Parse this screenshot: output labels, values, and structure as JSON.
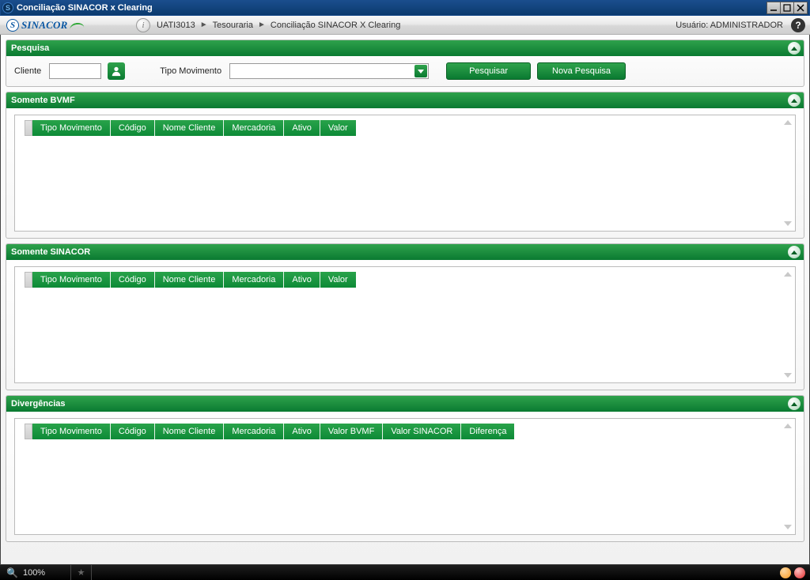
{
  "window": {
    "title": "Conciliação SINACOR x Clearing"
  },
  "logo": {
    "text": "SINACOR"
  },
  "breadcrumb": {
    "user": "UATI3013",
    "level1": "Tesouraria",
    "level2": "Conciliação SINACOR X Clearing"
  },
  "usuario": {
    "label": "Usuário:",
    "name": "ADMINISTRADOR"
  },
  "pesquisa": {
    "title": "Pesquisa",
    "cliente_label": "Cliente",
    "cliente_value": "",
    "tipo_mov_label": "Tipo Movimento",
    "tipo_mov_value": "",
    "btn_pesquisar": "Pesquisar",
    "btn_nova": "Nova Pesquisa"
  },
  "bvmf": {
    "title": "Somente BVMF",
    "columns": [
      "Tipo Movimento",
      "Código",
      "Nome Cliente",
      "Mercadoria",
      "Ativo",
      "Valor"
    ]
  },
  "sinacor": {
    "title": "Somente SINACOR",
    "columns": [
      "Tipo Movimento",
      "Código",
      "Nome Cliente",
      "Mercadoria",
      "Ativo",
      "Valor"
    ]
  },
  "diverg": {
    "title": "Divergências",
    "columns": [
      "Tipo Movimento",
      "Código",
      "Nome Cliente",
      "Mercadoria",
      "Ativo",
      "Valor BVMF",
      "Valor SINACOR",
      "Diferença"
    ]
  },
  "status": {
    "zoom": "100%"
  }
}
